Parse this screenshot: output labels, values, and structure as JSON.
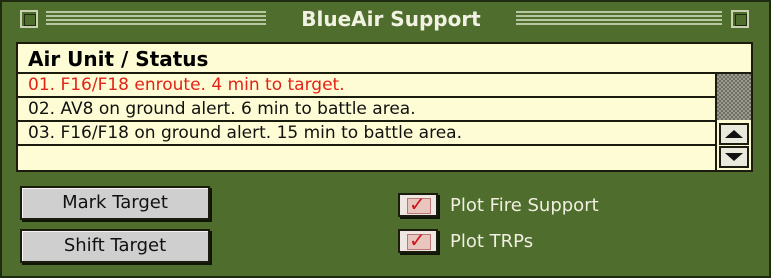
{
  "window": {
    "title": "BlueAir Support"
  },
  "list": {
    "header": "Air Unit / Status",
    "rows": [
      {
        "text": "01. F16/F18 enroute. 4 min to target.",
        "highlight_color": "#e2231a"
      },
      {
        "text": "02. AV8 on ground alert. 6 min to battle area."
      },
      {
        "text": "03. F16/F18 on ground alert. 15 min to battle area."
      },
      {
        "text": ""
      }
    ]
  },
  "buttons": {
    "mark_target": "Mark Target",
    "shift_target": "Shift Target"
  },
  "checkboxes": {
    "plot_fire_support": {
      "label": "Plot Fire Support",
      "checked": true
    },
    "plot_trps": {
      "label": "Plot TRPs",
      "checked": true
    }
  },
  "icons": {
    "check": "✓",
    "scroll_up": "up-arrow-icon",
    "scroll_down": "down-arrow-icon"
  },
  "colors": {
    "window_bg": "#4f6e2e",
    "list_bg": "#fdfcd4",
    "active_row_text": "#e2231a",
    "check_mark": "#d0121d"
  }
}
